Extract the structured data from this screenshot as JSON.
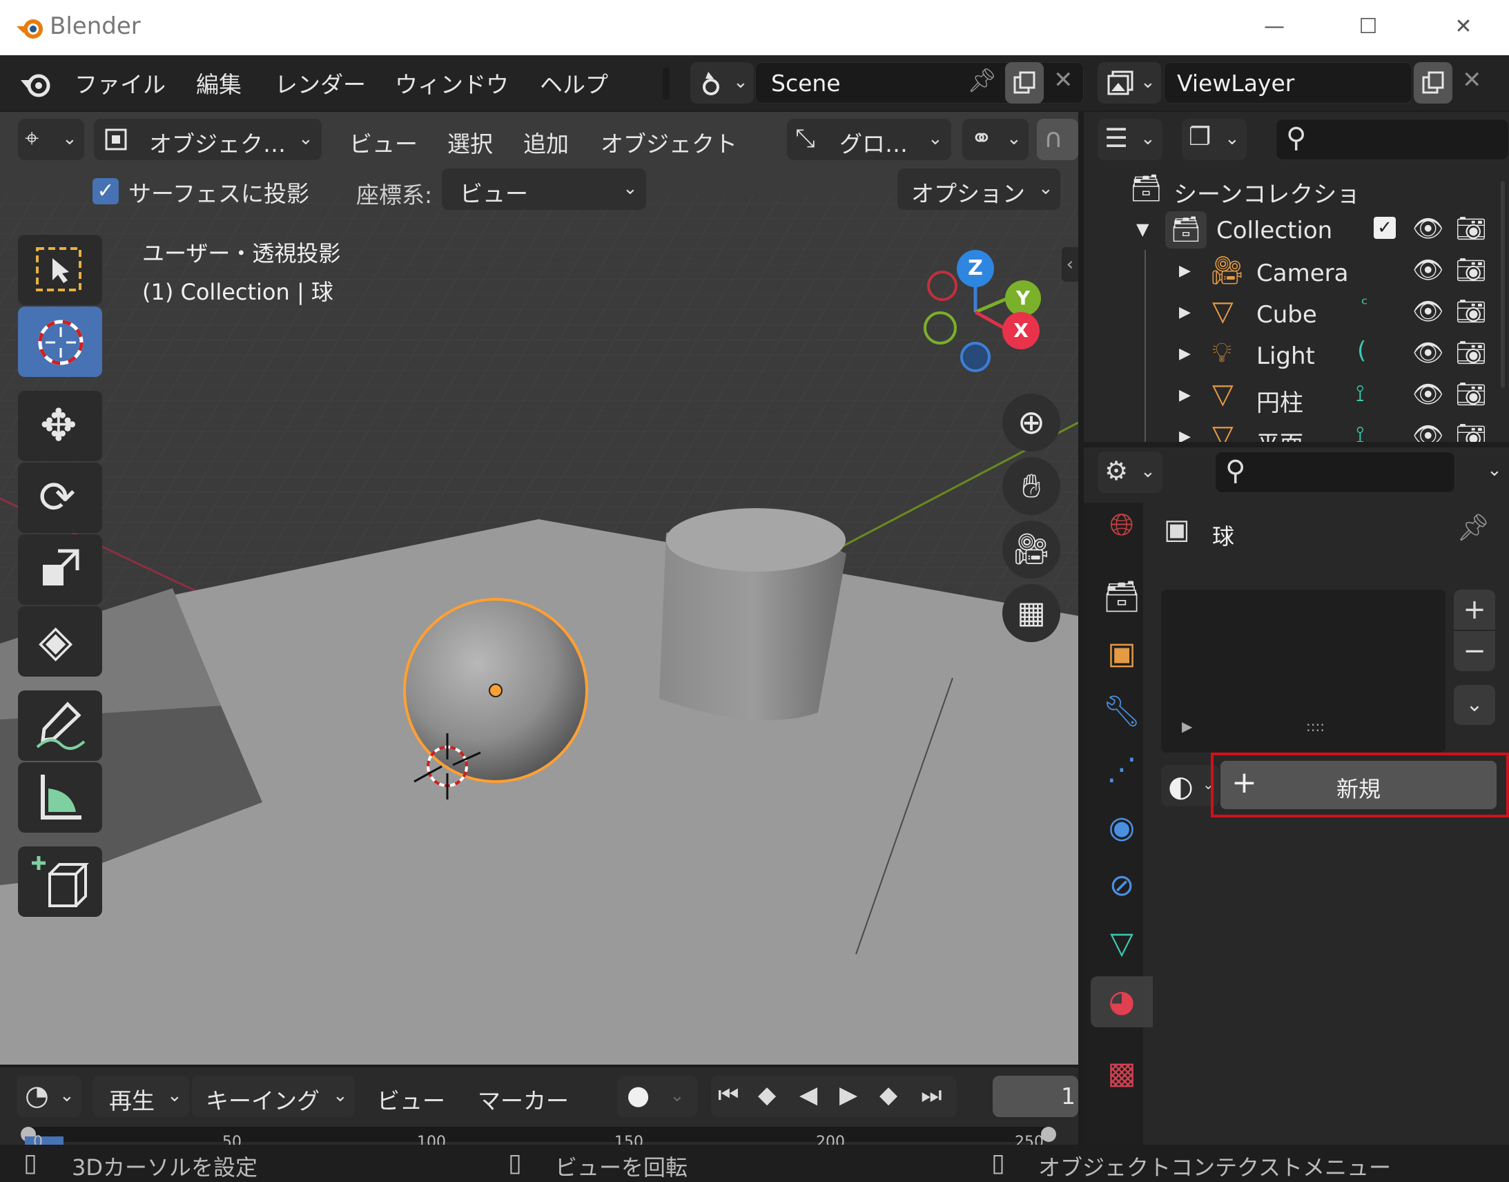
{
  "window": {
    "title": "Blender",
    "controls": [
      "—",
      "☐",
      "✕"
    ]
  },
  "menubar": {
    "items": [
      "ファイル",
      "編集",
      "レンダー",
      "ウィンドウ",
      "ヘルプ"
    ],
    "scene": "Scene",
    "view_layer": "ViewLayer"
  },
  "viewport": {
    "header": {
      "mode": "オブジェク…",
      "menus": [
        "ビュー",
        "選択",
        "追加",
        "オブジェクト"
      ],
      "transform": "グロ…"
    },
    "header2": {
      "snap_checkbox_label": "サーフェスに投影",
      "snap_checked": true,
      "coord_label": "座標系:",
      "coord_value": "ビュー",
      "options": "オプション"
    },
    "overlay": {
      "view_name": "ユーザー・透視投影",
      "collection_info": "(1) Collection | 球"
    },
    "gizmo": {
      "z": "Z",
      "y": "Y",
      "x": "X"
    },
    "tools": [
      "select-box",
      "cursor",
      "move",
      "rotate",
      "scale",
      "transform",
      "annotate",
      "measure",
      "add-cube"
    ],
    "active_tool": "cursor"
  },
  "outliner": {
    "root": "シーンコレクション",
    "collection": "Collection",
    "items": [
      {
        "name": "Camera",
        "icon": "camera-icon"
      },
      {
        "name": "Cube",
        "icon": "mesh-icon"
      },
      {
        "name": "Light",
        "icon": "light-icon"
      },
      {
        "name": "円柱",
        "icon": "mesh-icon"
      },
      {
        "name": "平面",
        "icon": "mesh-icon"
      }
    ]
  },
  "properties": {
    "object_name": "球",
    "new_button": "新規",
    "list_grip": "::::"
  },
  "timeline": {
    "menus": [
      "再生",
      "キーイング",
      "ビュー",
      "マーカー"
    ],
    "frame": "1",
    "ticks": [
      "0",
      "50",
      "100",
      "150",
      "200",
      "250"
    ]
  },
  "statusbar": {
    "left": "3Dカーソルを設定",
    "middle": "ビューを回転",
    "right": "オブジェクトコンテクストメニュー"
  },
  "colors": {
    "accent": "#4772b3",
    "highlight": "#d0111b",
    "selection": "#ffa033"
  }
}
